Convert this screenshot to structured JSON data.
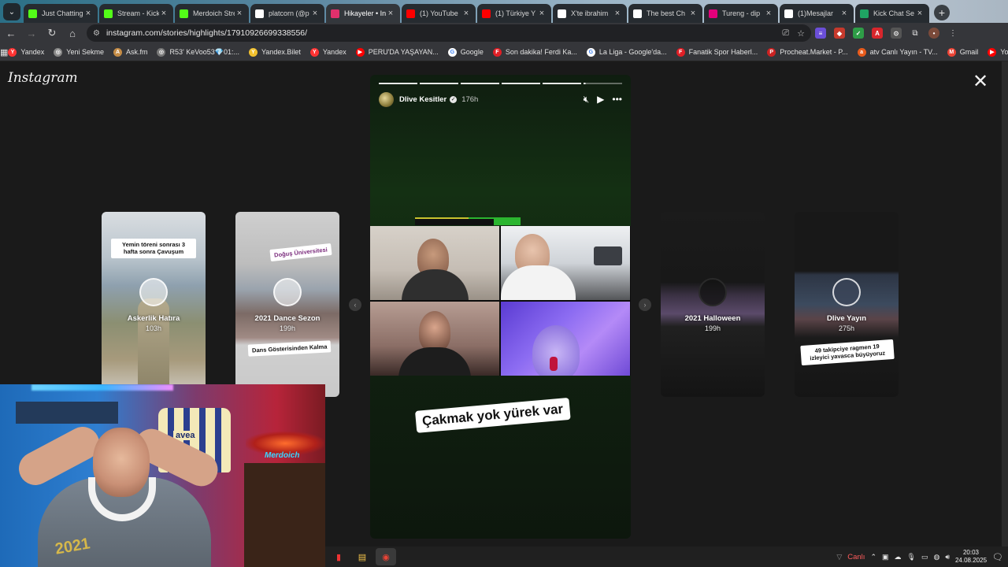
{
  "browser": {
    "tabs": [
      {
        "title": "Just Chatting",
        "favicon": "kick-icon",
        "color": "#53fc18",
        "active": false
      },
      {
        "title": "Stream - Kick",
        "favicon": "kick-icon",
        "color": "#53fc18",
        "active": false
      },
      {
        "title": "Merdoich Stream",
        "favicon": "kick-icon",
        "color": "#53fc18",
        "active": false
      },
      {
        "title": "platcorn (@p",
        "favicon": "x-icon",
        "color": "#ffffff",
        "active": false
      },
      {
        "title": "Hikayeler • In",
        "favicon": "instagram-icon",
        "color": "#e1306c",
        "active": true
      },
      {
        "title": "(1) YouTube",
        "favicon": "youtube-icon",
        "color": "#ff0000",
        "active": false
      },
      {
        "title": "(1) Türkiye Y",
        "favicon": "youtube-icon",
        "color": "#ff0000",
        "active": false
      },
      {
        "title": "X'te ibrahim",
        "favicon": "x-icon",
        "color": "#ffffff",
        "active": false
      },
      {
        "title": "The best Ch",
        "favicon": "diamond-icon",
        "color": "#ffffff",
        "active": false
      },
      {
        "title": "Tureng - dip",
        "favicon": "tureng-icon",
        "color": "#e3007b",
        "active": false
      },
      {
        "title": "(1)Mesajlar",
        "favicon": "tiktok-icon",
        "color": "#ffffff",
        "active": false
      },
      {
        "title": "Kick Chat Se",
        "favicon": "sheet-icon",
        "color": "#1fa463",
        "active": false
      }
    ],
    "url": "instagram.com/stories/highlights/17910926699338556/",
    "bookmarks": [
      {
        "label": "Yandex",
        "color": "#ff3333",
        "icon": "Y"
      },
      {
        "label": "Yeni Sekme",
        "color": "#888888",
        "icon": "◎"
      },
      {
        "label": "Ask.fm",
        "color": "#c58c46",
        "icon": "A"
      },
      {
        "label": "R53' KeVoo53💎01:...",
        "color": "#777777",
        "icon": "◎"
      },
      {
        "label": "Yandex.Bilet",
        "color": "#f2c12e",
        "icon": "Y"
      },
      {
        "label": "Yandex",
        "color": "#ff3333",
        "icon": "Y"
      },
      {
        "label": "PERU'DA YAŞAYAN...",
        "color": "#ff0000",
        "icon": "▶"
      },
      {
        "label": "Google",
        "color": "#ffffff",
        "icon": "G"
      },
      {
        "label": "Son dakika! Ferdi Ka...",
        "color": "#e01f26",
        "icon": "F"
      },
      {
        "label": "La Liga - Google'da...",
        "color": "#ffffff",
        "icon": "G"
      },
      {
        "label": "Fanatik Spor Haberl...",
        "color": "#e01f26",
        "icon": "F"
      },
      {
        "label": "Procheat.Market - P...",
        "color": "#cc2222",
        "icon": "P"
      },
      {
        "label": "atv Canlı Yayın - TV...",
        "color": "#e85b1c",
        "icon": "a"
      },
      {
        "label": "Gmail",
        "color": "#ea4335",
        "icon": "M"
      },
      {
        "label": "YouTube",
        "color": "#ff0000",
        "icon": "▶"
      }
    ]
  },
  "instagram": {
    "logo": "Instagram",
    "story": {
      "username": "Dlive Kesitler",
      "time_ago": "176h",
      "caption": "Çakmak yok yürek var",
      "progress_segments": 6,
      "current_progress": 0.05
    },
    "highlights_left": [
      {
        "title": "Askerlik Hatıra",
        "age": "103h",
        "sticker": "Yemin töreni sonrası 3 hafta sonra Çavuşum"
      },
      {
        "title": "2021 Dance Sezon",
        "age": "199h",
        "sticker": "Dans Gösterisinden Kalma",
        "sticker_top": "Doğuş Üniversitesi"
      }
    ],
    "highlights_right": [
      {
        "title": "2021 Halloween",
        "age": "199h"
      },
      {
        "title": "Dlive Yayın",
        "age": "275h",
        "sticker": "49 takipciye ragmen 19 izleyici yavasca büyüyoruz"
      }
    ]
  },
  "webcam": {
    "jersey_text": "avea",
    "neon_text": "Merdoich",
    "shirt_text": "2021"
  },
  "taskbar": {
    "live_label": "Canlı",
    "time": "20:03",
    "date": "24.08.2025"
  }
}
